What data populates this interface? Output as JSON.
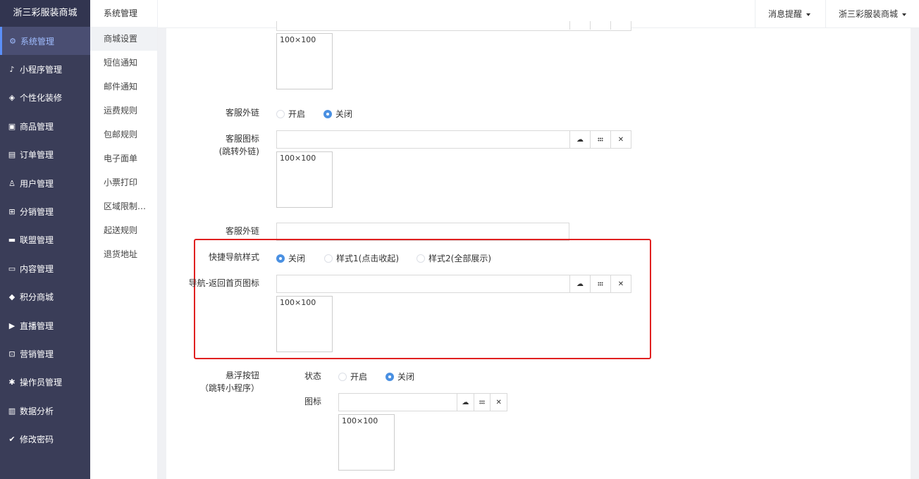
{
  "brand": "浙三彩服装商城",
  "nav": [
    {
      "label": "系统管理",
      "icon": "settings-icon",
      "glyph": "⚙",
      "active": true
    },
    {
      "label": "小程序管理",
      "icon": "tiktok-icon",
      "glyph": "♪"
    },
    {
      "label": "个性化装修",
      "icon": "layers-icon",
      "glyph": "◈"
    },
    {
      "label": "商品管理",
      "icon": "bag-icon",
      "glyph": "▣"
    },
    {
      "label": "订单管理",
      "icon": "clipboard-icon",
      "glyph": "▤"
    },
    {
      "label": "用户管理",
      "icon": "user-icon",
      "glyph": "♙"
    },
    {
      "label": "分销管理",
      "icon": "sitemap-icon",
      "glyph": "⊞"
    },
    {
      "label": "联盟管理",
      "icon": "store-icon",
      "glyph": "▬"
    },
    {
      "label": "内容管理",
      "icon": "newspaper-icon",
      "glyph": "▭"
    },
    {
      "label": "积分商城",
      "icon": "cube-icon",
      "glyph": "◆"
    },
    {
      "label": "直播管理",
      "icon": "play-icon",
      "glyph": "▶"
    },
    {
      "label": "营销管理",
      "icon": "coupon-icon",
      "glyph": "⊡"
    },
    {
      "label": "操作员管理",
      "icon": "gear-icon",
      "glyph": "✱"
    },
    {
      "label": "数据分析",
      "icon": "bar-chart-icon",
      "glyph": "▥"
    },
    {
      "label": "修改密码",
      "icon": "shield-check-icon",
      "glyph": "✔"
    }
  ],
  "submenu": {
    "title": "系统管理",
    "items": [
      "商城设置",
      "短信通知",
      "邮件通知",
      "运费规则",
      "包邮规则",
      "电子面单",
      "小票打印",
      "区域限制…",
      "起送规则",
      "退货地址"
    ]
  },
  "header": {
    "notifications": "消息提醒",
    "store": "浙三彩服装商城"
  },
  "thumb_placeholder": "100×100",
  "form": {
    "service_link_toggle": {
      "label": "客服外链",
      "on": "开启",
      "off": "关闭"
    },
    "service_icon": {
      "label": "客服图标",
      "sublabel": "(跳转外链)"
    },
    "service_link_url": {
      "label": "客服外链",
      "value": ""
    },
    "quick_nav": {
      "label": "快捷导航样式",
      "options": [
        "关闭",
        "样式1(点击收起)",
        "样式2(全部展示)"
      ]
    },
    "nav_home_icon": {
      "label": "导航-返回首页图标"
    },
    "float_button": {
      "label": "悬浮按钮",
      "sublabel": "（跳转小程序）",
      "status_label": "状态",
      "on": "开启",
      "off": "关闭",
      "icon_label": "图标"
    }
  }
}
